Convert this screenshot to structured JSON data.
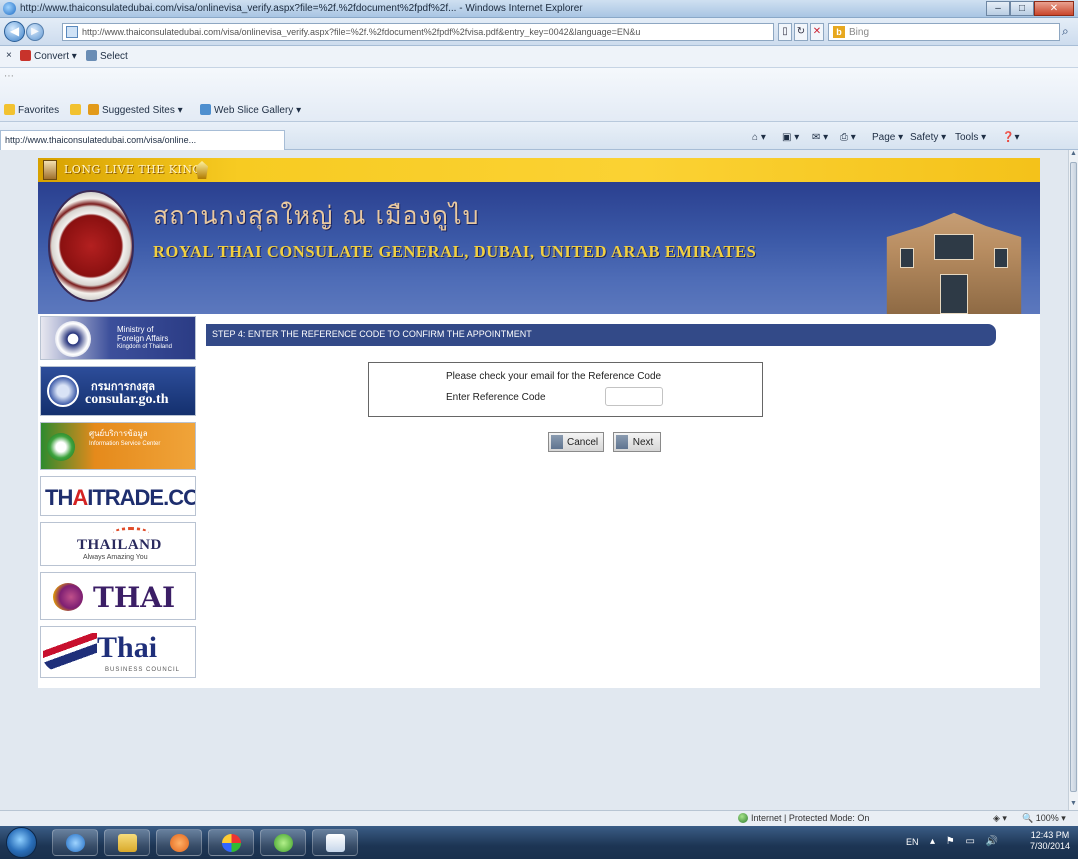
{
  "window": {
    "title": "http://www.thaiconsulatedubai.com/visa/onlinevisa_verify.aspx?file=%2f.%2fdocument%2fpdf%2f... - Windows Internet Explorer",
    "controls": {
      "minimize": "–",
      "maximize": "□",
      "close": "✕"
    }
  },
  "address_bar": {
    "url": "http://www.thaiconsulatedubai.com/visa/onlinevisa_verify.aspx?file=%2f.%2fdocument%2fpdf%2fvisa.pdf&entry_key=0042&language=EN&u",
    "refresh": "↻",
    "stop": "✕",
    "search_placeholder": "Bing",
    "search_icon": "search-icon"
  },
  "command_bar": {
    "convert": "Convert",
    "select": "Select"
  },
  "favorites_bar": {
    "favorites": "Favorites",
    "suggested_sites": "Suggested Sites",
    "web_slice_gallery": "Web Slice Gallery"
  },
  "tab": {
    "title": "http://www.thaiconsulatedubai.com/visa/online..."
  },
  "tools": {
    "page": "Page",
    "safety": "Safety",
    "tools": "Tools"
  },
  "site": {
    "top_strip": "LONG LIVE THE KING",
    "banner": {
      "thai_name": "สถานกงสุลใหญ่ ณ เมืองดูไบ",
      "english_name": "ROYAL THAI CONSULATE GENERAL, DUBAI, UNITED ARAB EMIRATES"
    },
    "sidebar": {
      "mfa": {
        "line1": "Ministry of",
        "line2": "Foreign Affairs",
        "line3": "Kingdom of Thailand"
      },
      "consular": {
        "thai": "กรมการกงสุล",
        "domain": "consular.go.th"
      },
      "orange": {
        "thai": "ศูนย์บริการข้อมูล",
        "sub": "Information Service Center"
      },
      "thaitrade": {
        "pre": "TH",
        "accent": "A",
        "post": "ITRADE.COM"
      },
      "amazing": {
        "title": "THAILAND",
        "tagline": "Always Amazing You"
      },
      "thai_airways": {
        "name": "THAI"
      },
      "thai_business": {
        "name": "Thai",
        "sub": "BUSINESS COUNCIL"
      }
    },
    "step_header": "STEP 4: ENTER THE REFERENCE CODE TO CONFIRM THE APPOINTMENT",
    "form": {
      "instruction": "Please check your email for the Reference Code",
      "field_label": "Enter Reference Code",
      "field_value": "",
      "cancel_label": "Cancel",
      "next_label": "Next"
    }
  },
  "status_bar": {
    "zone": "Internet | Protected Mode: On",
    "zoom": "100%",
    "security_icon": "shield-icon"
  },
  "taskbar": {
    "language": "EN",
    "time": "12:43 PM",
    "date": "7/30/2014"
  },
  "colors": {
    "banner_blue": "#3c5aa8",
    "gold": "#f7cb22",
    "step_header": "#334a88",
    "taskbar": "#1d3554"
  }
}
